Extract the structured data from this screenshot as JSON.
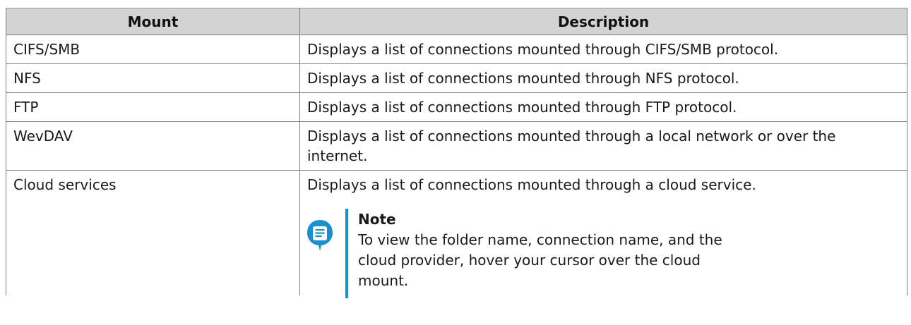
{
  "table": {
    "headers": [
      "Mount",
      "Description"
    ],
    "rows": [
      {
        "mount": "CIFS/SMB",
        "description": "Displays a list of connections mounted through CIFS/SMB protocol."
      },
      {
        "mount": "NFS",
        "description": "Displays a list of connections mounted through NFS protocol."
      },
      {
        "mount": "FTP",
        "description": "Displays a list of connections mounted through FTP protocol."
      },
      {
        "mount": "WevDAV",
        "description": "Displays a list of connections mounted through a local network or over the internet."
      },
      {
        "mount": "Cloud services",
        "description": "Displays a list of connections mounted through a cloud service."
      }
    ],
    "note": {
      "title": "Note",
      "text": "To view the folder name, connection name, and the cloud provider, hover your cursor over the cloud mount.",
      "icon": "note-icon",
      "accent_color": "#1a8fd0"
    }
  }
}
